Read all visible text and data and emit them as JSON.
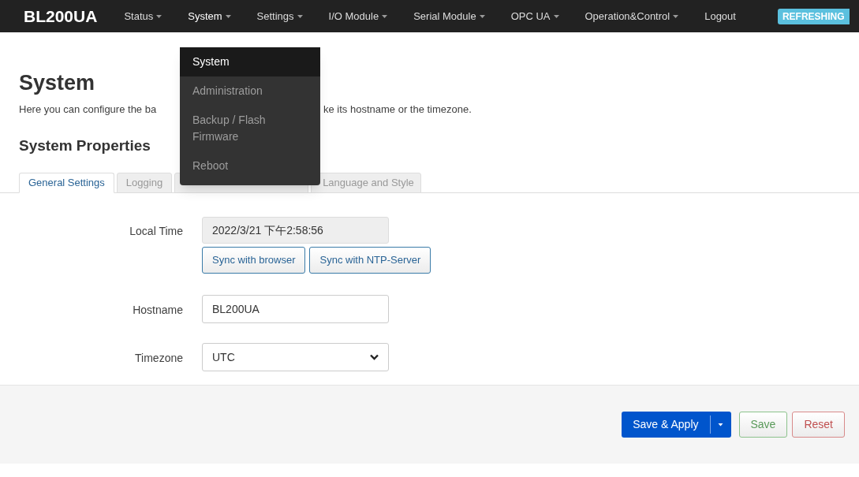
{
  "navbar": {
    "brand": "BL200UA",
    "menus": [
      {
        "label": "Status",
        "has_caret": true,
        "open": false
      },
      {
        "label": "System",
        "has_caret": true,
        "open": true
      },
      {
        "label": "Settings",
        "has_caret": true,
        "open": false
      },
      {
        "label": "I/O Module",
        "has_caret": true,
        "open": false
      },
      {
        "label": "Serial Module",
        "has_caret": true,
        "open": false
      },
      {
        "label": "OPC UA",
        "has_caret": true,
        "open": false
      },
      {
        "label": "Operation&Control",
        "has_caret": true,
        "open": false
      },
      {
        "label": "Logout",
        "has_caret": false,
        "open": false
      }
    ],
    "badge": "REFRESHING"
  },
  "dropdown": {
    "items": [
      {
        "label": "System",
        "selected": true
      },
      {
        "label": "Administration",
        "selected": false
      },
      {
        "label": "Backup / Flash Firmware",
        "selected": false
      },
      {
        "label": "Reboot",
        "selected": false
      }
    ]
  },
  "page": {
    "title": "System",
    "description_parts": [
      "Here you can configure the ba",
      "ke its hostname or the timezone."
    ],
    "section": "System Properties"
  },
  "tabs": [
    {
      "label": "General Settings",
      "selected": true
    },
    {
      "label": "Logging",
      "selected": false
    },
    {
      "selected": false
    },
    {
      "label": "Language and Style",
      "selected": false
    }
  ],
  "form": {
    "local_time": {
      "label": "Local Time",
      "value": "2022/3/21 下午2:58:56",
      "buttons": [
        "Sync with browser",
        "Sync with NTP-Server"
      ]
    },
    "hostname": {
      "label": "Hostname",
      "value": "BL200UA"
    },
    "timezone": {
      "label": "Timezone",
      "value": "UTC"
    }
  },
  "footer": {
    "buttons": [
      {
        "label": "Save & Apply",
        "kind": "primary"
      },
      {
        "label": "Save",
        "kind": "save"
      },
      {
        "label": "Reset",
        "kind": "reset"
      }
    ]
  }
}
